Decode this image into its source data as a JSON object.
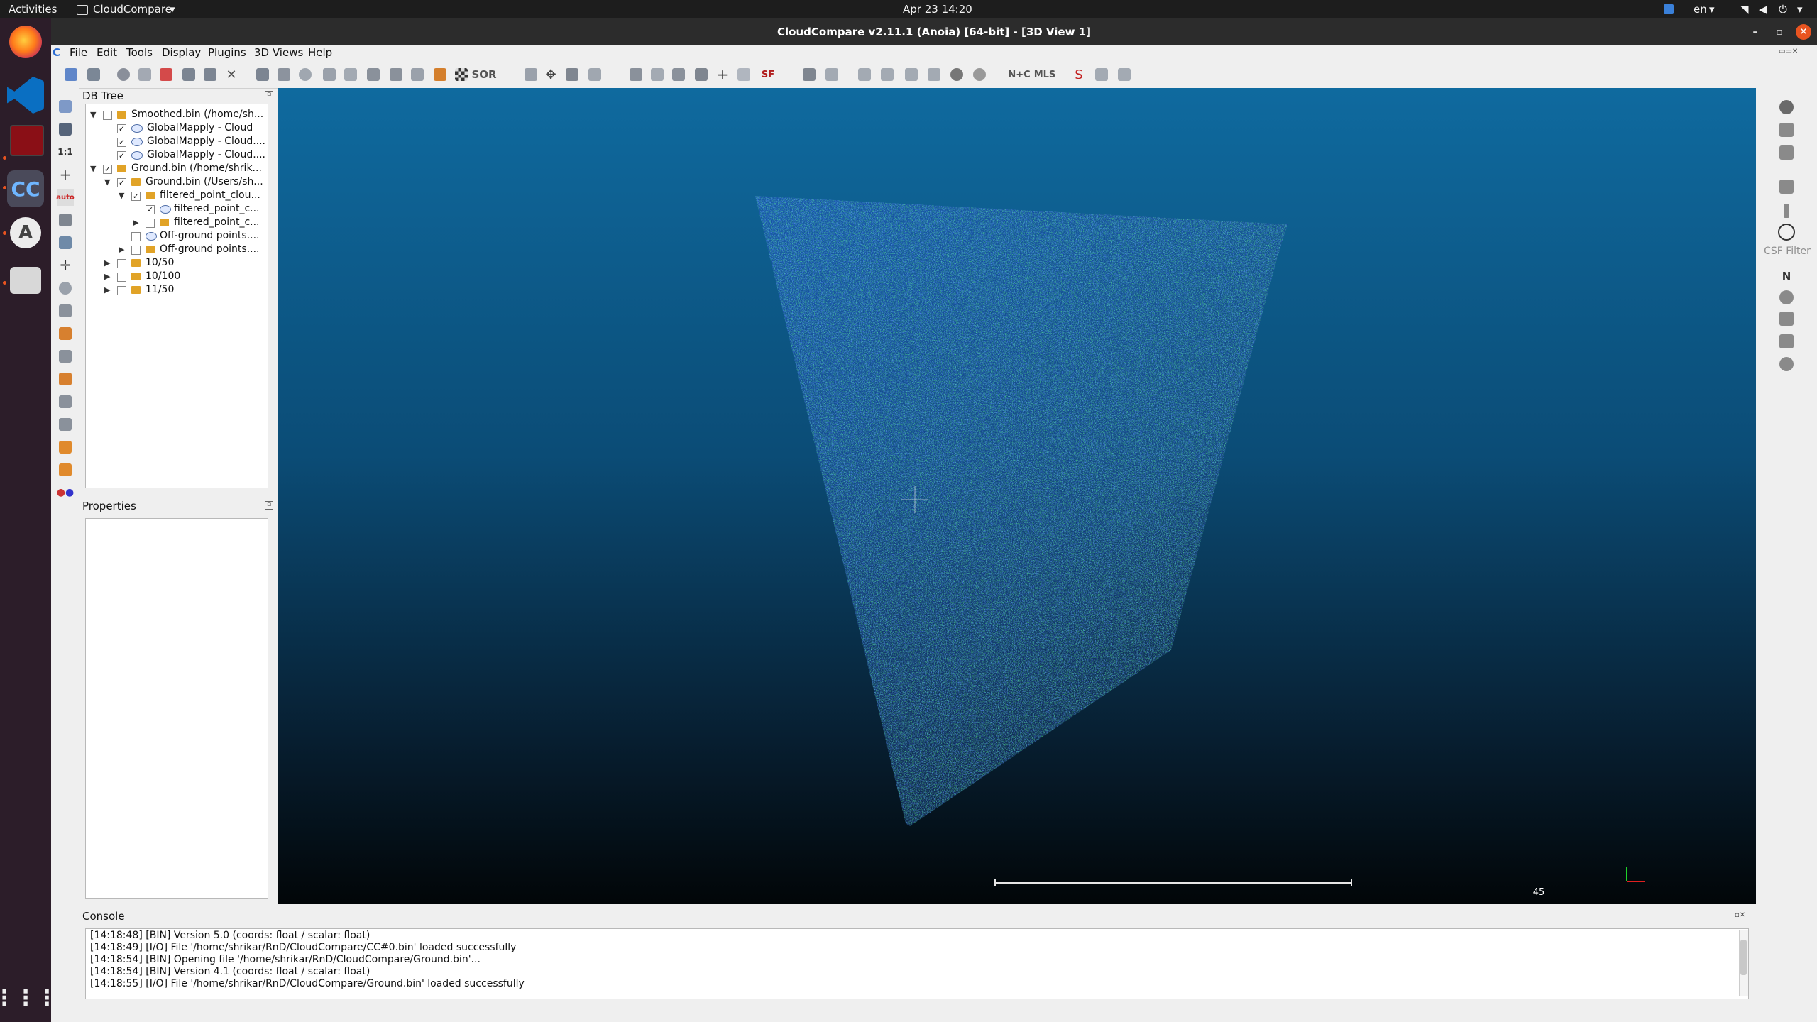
{
  "system_bar": {
    "activities": "Activities",
    "app_menu": "CloudCompare",
    "clock": "Apr 23  14:20",
    "language": "en"
  },
  "window": {
    "title": "CloudCompare v2.11.1 (Anoia) [64-bit] - [3D View 1]"
  },
  "menubar": {
    "items": [
      "File",
      "Edit",
      "Tools",
      "Display",
      "Plugins",
      "3D Views",
      "Help"
    ]
  },
  "db_tree": {
    "title": "DB Tree",
    "rows": [
      {
        "label": "Smoothed.bin (/home/sh...",
        "checked": false
      },
      {
        "label": "GlobalMapply - Cloud",
        "checked": true
      },
      {
        "label": "GlobalMapply - Cloud....",
        "checked": true
      },
      {
        "label": "GlobalMapply - Cloud....",
        "checked": true
      },
      {
        "label": "Ground.bin (/home/shrik...",
        "checked": true
      },
      {
        "label": "Ground.bin (/Users/sh...",
        "checked": true
      },
      {
        "label": "filtered_point_clou...",
        "checked": true
      },
      {
        "label": "filtered_point_c...",
        "checked": true
      },
      {
        "label": "filtered_point_c...",
        "checked": false
      },
      {
        "label": "Off-ground points....",
        "checked": false
      },
      {
        "label": "Off-ground points....",
        "checked": false
      },
      {
        "label": "10/50",
        "checked": false
      },
      {
        "label": "10/100",
        "checked": false
      },
      {
        "label": "11/50",
        "checked": false
      }
    ]
  },
  "properties": {
    "title": "Properties"
  },
  "toolbar": {
    "sor_label": "SOR",
    "sf_label": "SF",
    "mls_label": "MLS",
    "nc_label": "N+C"
  },
  "right_toolbar": {
    "csf_label": "CSF Filter",
    "n_label": "N"
  },
  "view3d": {
    "scale_label": "45"
  },
  "console": {
    "title": "Console",
    "lines": [
      "[14:18:48] [BIN] Version 5.0 (coords: float / scalar: float)",
      "[14:18:49] [I/O] File '/home/shrikar/RnD/CloudCompare/CC#0.bin' loaded successfully",
      "[14:18:54] [BIN] Opening file '/home/shrikar/RnD/CloudCompare/Ground.bin'...",
      "[14:18:54] [BIN] Version 4.1 (coords: float / scalar: float)",
      "[14:18:55] [I/O] File '/home/shrikar/RnD/CloudCompare/Ground.bin' loaded successfully"
    ]
  }
}
